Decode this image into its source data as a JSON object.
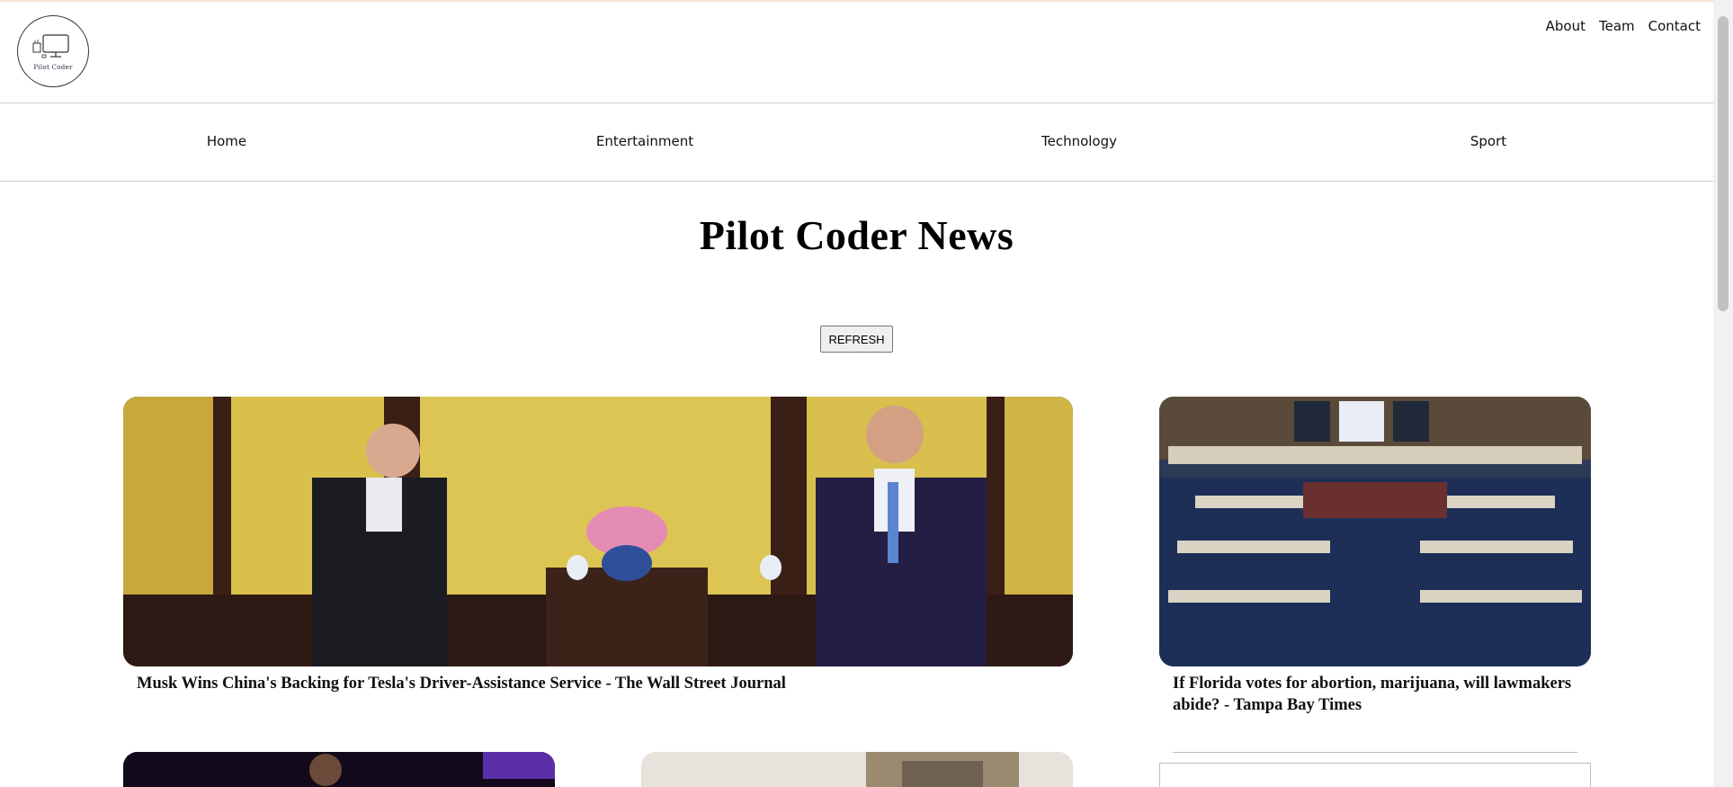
{
  "brand": {
    "logo_text": "Pilot Coder"
  },
  "top_nav": {
    "about": "About",
    "team": "Team",
    "contact": "Contact"
  },
  "categories": {
    "home": "Home",
    "entertainment": "Entertainment",
    "technology": "Technology",
    "sport": "Sport"
  },
  "main": {
    "title": "Pilot Coder News",
    "refresh_label": "REFRESH"
  },
  "articles": [
    {
      "title": "Musk Wins China's Backing for Tesla's Driver-Assistance Service - The Wall Street Journal"
    },
    {
      "title": "If Florida votes for abortion, marijuana, will lawmakers abide? - Tampa Bay Times"
    }
  ],
  "colors": {
    "top_accent": "#fbe3d9",
    "border": "#cfcfcf"
  }
}
